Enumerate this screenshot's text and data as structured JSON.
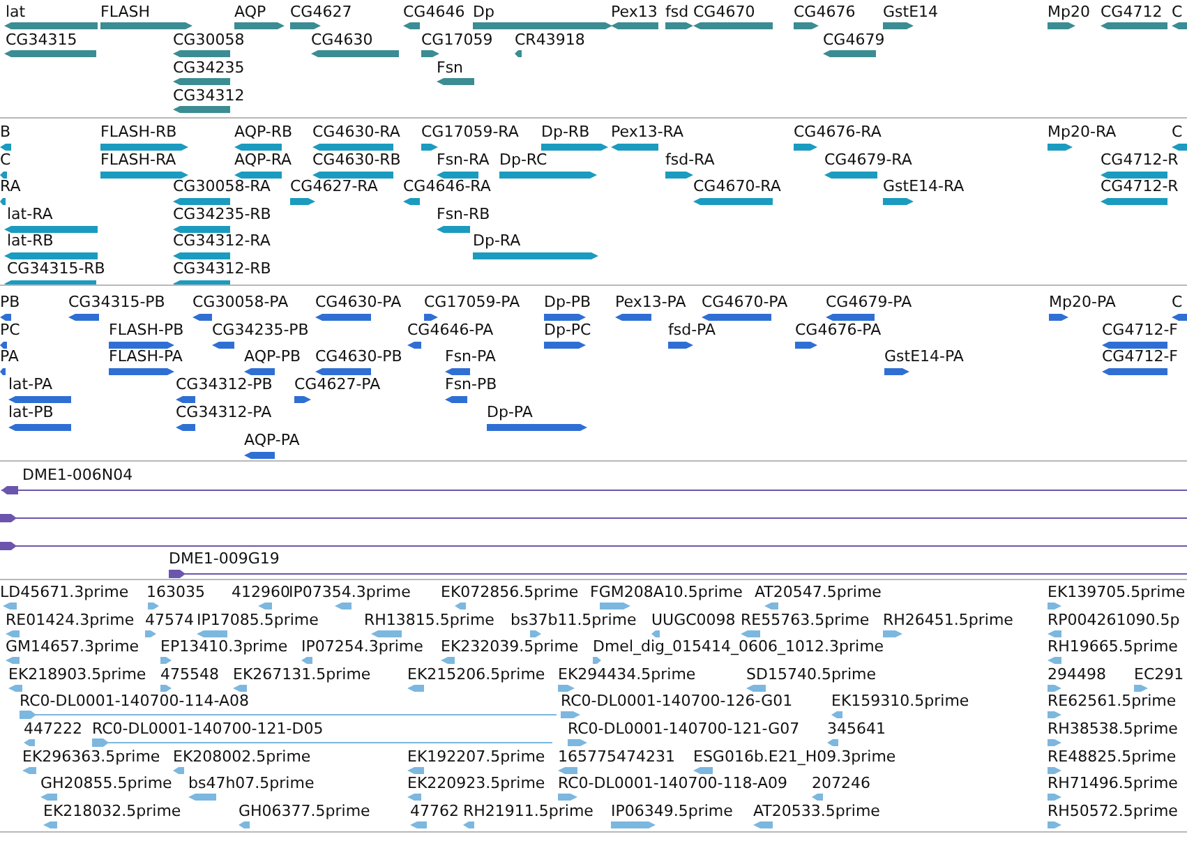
{
  "tracks": [
    {
      "kind": "gene",
      "lanes": [
        {
          "features": [
            {
              "label": "lat",
              "reverse": true
            },
            {
              "label": "FLASH",
              "reverse": false
            },
            {
              "label": "AQP",
              "reverse": false
            },
            {
              "label": "CG4627",
              "reverse": false
            },
            {
              "label": "CG4646",
              "reverse": true
            },
            {
              "label": "Dp",
              "reverse": false
            },
            {
              "label": "Pex13",
              "reverse": true
            },
            {
              "label": "fsd",
              "reverse": false
            },
            {
              "label": "CG4670",
              "reverse": true
            },
            {
              "label": "CG4676",
              "reverse": false
            },
            {
              "label": "GstE14",
              "reverse": false
            },
            {
              "label": "Mp20",
              "reverse": false
            },
            {
              "label": "CG4712",
              "reverse": true
            },
            {
              "label": "C",
              "reverse": true
            }
          ]
        },
        {
          "features": [
            {
              "label": "CG34315",
              "reverse": true
            },
            {
              "label": "CG30058",
              "reverse": true
            },
            {
              "label": "CG4630",
              "reverse": true
            },
            {
              "label": "CG17059",
              "reverse": false
            },
            {
              "label": "CR43918",
              "reverse": true
            },
            {
              "label": "CG4679",
              "reverse": true
            }
          ]
        },
        {
          "features": [
            {
              "label": "CG34235",
              "reverse": true
            },
            {
              "label": "Fsn",
              "reverse": true
            }
          ]
        },
        {
          "features": [
            {
              "label": "CG34312",
              "reverse": true
            }
          ]
        }
      ]
    },
    {
      "kind": "transcript",
      "lanes": [
        {
          "features": [
            {
              "label": "B",
              "reverse": true
            },
            {
              "label": "FLASH-RB",
              "reverse": false
            },
            {
              "label": "AQP-RB",
              "reverse": true
            },
            {
              "label": "CG4630-RA",
              "reverse": true
            },
            {
              "label": "CG17059-RA",
              "reverse": false
            },
            {
              "label": "Dp-RB",
              "reverse": false
            },
            {
              "label": "Pex13-RA",
              "reverse": true
            },
            {
              "label": "CG4676-RA",
              "reverse": false
            },
            {
              "label": "Mp20-RA",
              "reverse": false
            },
            {
              "label": "C",
              "reverse": true
            }
          ]
        },
        {
          "features": [
            {
              "label": "C",
              "reverse": true
            },
            {
              "label": "FLASH-RA",
              "reverse": false
            },
            {
              "label": "AQP-RA",
              "reverse": true
            },
            {
              "label": "CG4630-RB",
              "reverse": true
            },
            {
              "label": "Fsn-RA",
              "reverse": true
            },
            {
              "label": "Dp-RC",
              "reverse": false
            },
            {
              "label": "fsd-RA",
              "reverse": false
            },
            {
              "label": "CG4679-RA",
              "reverse": true
            },
            {
              "label": "CG4712-R",
              "reverse": true
            }
          ]
        },
        {
          "features": [
            {
              "label": "RA",
              "reverse": true
            },
            {
              "label": "CG30058-RA",
              "reverse": true
            },
            {
              "label": "CG4627-RA",
              "reverse": false
            },
            {
              "label": "CG4646-RA",
              "reverse": true
            },
            {
              "label": "CG4670-RA",
              "reverse": true
            },
            {
              "label": "GstE14-RA",
              "reverse": false
            },
            {
              "label": "CG4712-R",
              "reverse": true
            }
          ]
        },
        {
          "features": [
            {
              "label": "lat-RA",
              "reverse": true
            },
            {
              "label": "CG34235-RB",
              "reverse": true
            },
            {
              "label": "Fsn-RB",
              "reverse": true
            }
          ]
        },
        {
          "features": [
            {
              "label": "lat-RB",
              "reverse": true
            },
            {
              "label": "CG34312-RA",
              "reverse": true
            },
            {
              "label": "Dp-RA",
              "reverse": false
            }
          ]
        },
        {
          "features": [
            {
              "label": "CG34315-RB",
              "reverse": true
            },
            {
              "label": "CG34312-RB",
              "reverse": true
            }
          ]
        }
      ]
    },
    {
      "kind": "protein",
      "lanes": [
        {
          "features": [
            {
              "label": "PB",
              "reverse": true
            },
            {
              "label": "CG34315-PB",
              "reverse": true
            },
            {
              "label": "CG30058-PA",
              "reverse": true
            },
            {
              "label": "CG4630-PA",
              "reverse": true
            },
            {
              "label": "CG17059-PA",
              "reverse": false
            },
            {
              "label": "Dp-PB",
              "reverse": false
            },
            {
              "label": "Pex13-PA",
              "reverse": true
            },
            {
              "label": "CG4670-PA",
              "reverse": true
            },
            {
              "label": "CG4679-PA",
              "reverse": true
            },
            {
              "label": "Mp20-PA",
              "reverse": false
            },
            {
              "label": "C",
              "reverse": true
            }
          ]
        },
        {
          "features": [
            {
              "label": "PC",
              "reverse": true
            },
            {
              "label": "FLASH-PB",
              "reverse": false
            },
            {
              "label": "CG34235-PB",
              "reverse": true
            },
            {
              "label": "CG4646-PA",
              "reverse": true
            },
            {
              "label": "Dp-PC",
              "reverse": false
            },
            {
              "label": "fsd-PA",
              "reverse": false
            },
            {
              "label": "CG4676-PA",
              "reverse": false
            },
            {
              "label": "CG4712-F",
              "reverse": true
            }
          ]
        },
        {
          "features": [
            {
              "label": "PA",
              "reverse": true
            },
            {
              "label": "FLASH-PA",
              "reverse": false
            },
            {
              "label": "AQP-PB",
              "reverse": true
            },
            {
              "label": "CG4630-PB",
              "reverse": true
            },
            {
              "label": "Fsn-PA",
              "reverse": true
            },
            {
              "label": "GstE14-PA",
              "reverse": false
            },
            {
              "label": "CG4712-F",
              "reverse": true
            }
          ]
        },
        {
          "features": [
            {
              "label": "lat-PA",
              "reverse": true
            },
            {
              "label": "CG34312-PB",
              "reverse": true
            },
            {
              "label": "CG4627-PA",
              "reverse": false
            },
            {
              "label": "Fsn-PB",
              "reverse": true
            }
          ]
        },
        {
          "features": [
            {
              "label": "lat-PB",
              "reverse": true
            },
            {
              "label": "CG34312-PA",
              "reverse": true
            },
            {
              "label": "Dp-PA",
              "reverse": false
            }
          ]
        },
        {
          "features": [
            {
              "label": "AQP-PA",
              "reverse": true
            }
          ]
        }
      ]
    },
    {
      "kind": "clone",
      "lanes": [
        {
          "features": [
            {
              "label": "DME1-006N04",
              "reverse": true
            }
          ]
        },
        {
          "features": [
            {
              "reverse": false
            }
          ]
        },
        {
          "features": [
            {
              "reverse": false
            }
          ]
        },
        {
          "features": [
            {
              "label": "DME1-009G19",
              "reverse": false
            }
          ]
        }
      ]
    },
    {
      "kind": "est",
      "lanes": [
        {
          "features": [
            {
              "label": "LD45671.3prime",
              "reverse": true
            },
            {
              "label": "163035",
              "reverse": false
            },
            {
              "label": "412960",
              "reverse": true
            },
            {
              "label": "IP07354.3prime",
              "reverse": true
            },
            {
              "label": "EK072856.5prime",
              "reverse": true
            },
            {
              "label": "FGM208A10.5prime",
              "reverse": false
            },
            {
              "label": "AT20547.5prime",
              "reverse": true
            },
            {
              "label": "EK139705.5prime",
              "reverse": false
            }
          ]
        },
        {
          "features": [
            {
              "label": "RE01424.3prime",
              "reverse": true
            },
            {
              "label": "47574",
              "reverse": false
            },
            {
              "label": "IP17085.5prime",
              "reverse": true
            },
            {
              "label": "RH13815.5prime",
              "reverse": true
            },
            {
              "label": "bs37b11.5prime",
              "reverse": false
            },
            {
              "label": "UUGC0098",
              "reverse": true
            },
            {
              "label": "RE55763.5prime",
              "reverse": true
            },
            {
              "label": "RH26451.5prime",
              "reverse": false
            },
            {
              "label": "RP004261090.5p",
              "reverse": true
            }
          ]
        },
        {
          "features": [
            {
              "label": "GM14657.3prime",
              "reverse": true
            },
            {
              "label": "EP13410.3prime",
              "reverse": false
            },
            {
              "label": "IP07254.3prime",
              "reverse": true
            },
            {
              "label": "EK232039.5prime",
              "reverse": true
            },
            {
              "label": "Dmel_dig_015414_0606_1012.3prime",
              "reverse": false
            },
            {
              "label": "RH19665.5prime",
              "reverse": true
            }
          ]
        },
        {
          "features": [
            {
              "label": "EK218903.5prime",
              "reverse": true
            },
            {
              "label": "475548",
              "reverse": false
            },
            {
              "label": "EK267131.5prime",
              "reverse": true
            },
            {
              "label": "EK215206.5prime",
              "reverse": true
            },
            {
              "label": "EK294434.5prime",
              "reverse": false
            },
            {
              "label": "SD15740.5prime",
              "reverse": true
            },
            {
              "label": "294498",
              "reverse": false
            },
            {
              "label": "EC291",
              "reverse": false
            }
          ]
        },
        {
          "features": [
            {
              "label": "RC0-DL0001-140700-114-A08",
              "reverse": false
            },
            {
              "label": "RC0-DL0001-140700-126-G01",
              "reverse": false
            },
            {
              "label": "EK159310.5prime",
              "reverse": true
            },
            {
              "label": "RE62561.5prime",
              "reverse": false
            }
          ]
        },
        {
          "features": [
            {
              "label": "447222",
              "reverse": true
            },
            {
              "label": "RC0-DL0001-140700-121-D05",
              "reverse": false
            },
            {
              "label": "RC0-DL0001-140700-121-G07",
              "reverse": false
            },
            {
              "label": "345641",
              "reverse": true
            },
            {
              "label": "RH38538.5prime",
              "reverse": false
            }
          ]
        },
        {
          "features": [
            {
              "label": "EK296363.5prime",
              "reverse": true
            },
            {
              "label": "EK208002.5prime",
              "reverse": true
            },
            {
              "label": "EK192207.5prime",
              "reverse": true
            },
            {
              "label": "165775474231",
              "reverse": true
            },
            {
              "label": "ESG016b.E21_H09.3prime",
              "reverse": true
            },
            {
              "label": "RE48825.5prime",
              "reverse": false
            }
          ]
        },
        {
          "features": [
            {
              "label": "GH20855.5prime",
              "reverse": true
            },
            {
              "label": "bs47h07.5prime",
              "reverse": true
            },
            {
              "label": "EK220923.5prime",
              "reverse": true
            },
            {
              "label": "RC0-DL0001-140700-118-A09",
              "reverse": false
            },
            {
              "label": "207246",
              "reverse": true
            },
            {
              "label": "RH71496.5prime",
              "reverse": false
            }
          ]
        },
        {
          "features": [
            {
              "label": "EK218032.5prime",
              "reverse": true
            },
            {
              "label": "GH06377.5prime",
              "reverse": true
            },
            {
              "label": "47762",
              "reverse": true
            },
            {
              "label": "RH21911.5prime",
              "reverse": true
            },
            {
              "label": "IP06349.5prime",
              "reverse": false
            },
            {
              "label": "AT20533.5prime",
              "reverse": true
            },
            {
              "label": "RH50572.5prime",
              "reverse": false
            }
          ]
        }
      ]
    }
  ]
}
